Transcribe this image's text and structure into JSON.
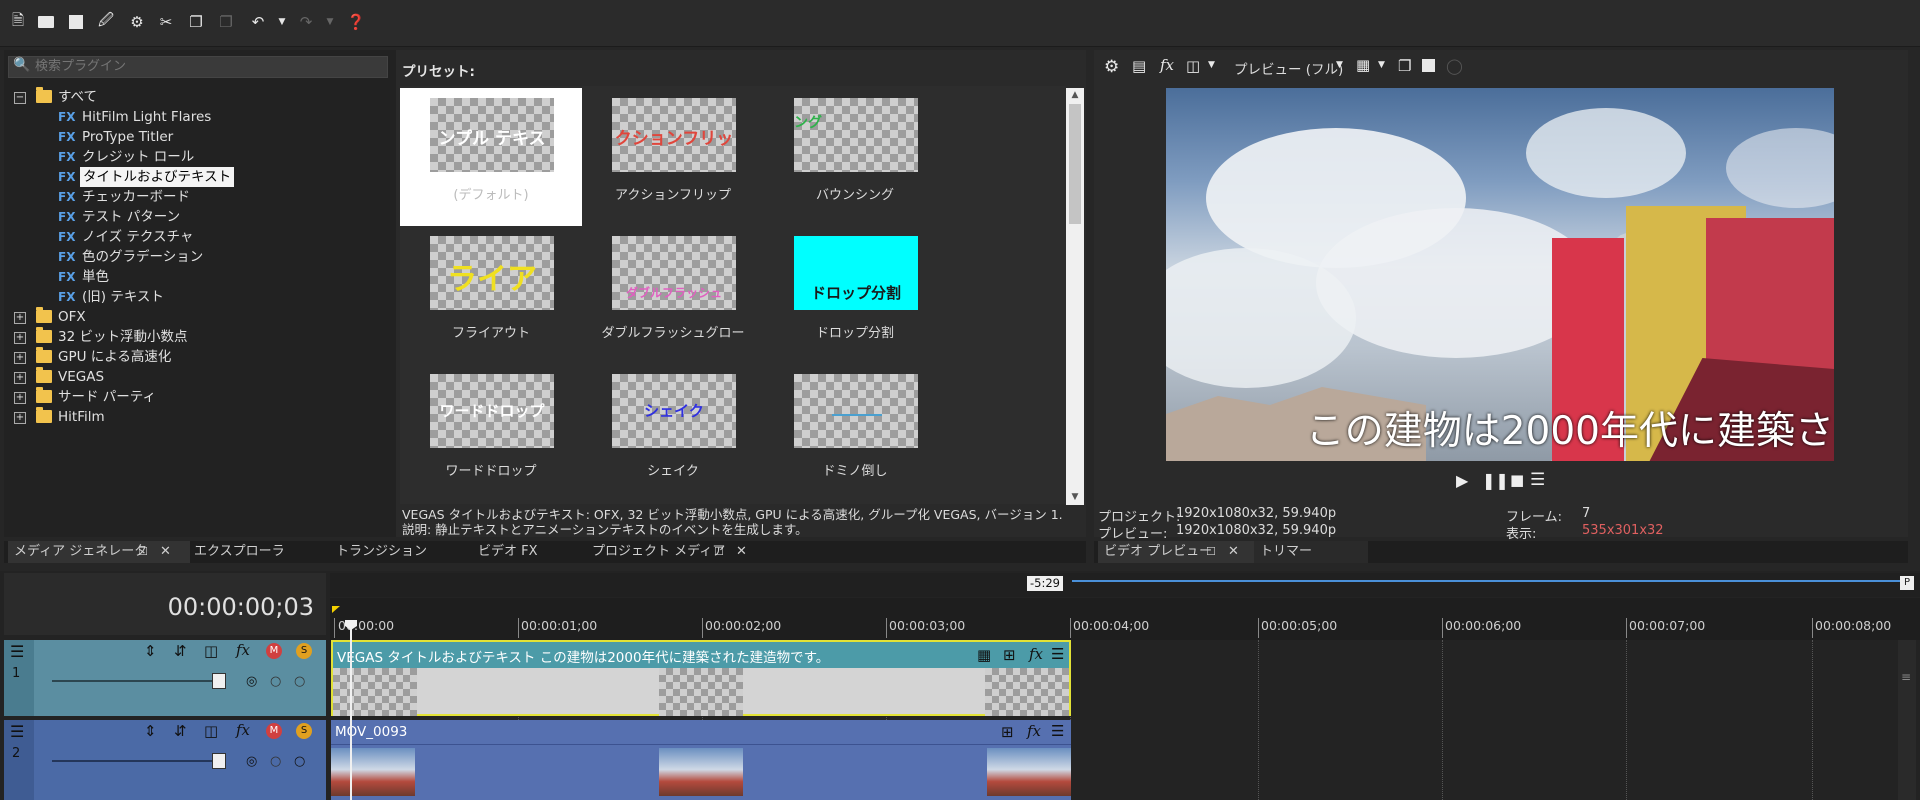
{
  "toolbar": {
    "icons": [
      "new-file-icon",
      "open-folder-icon",
      "save-icon",
      "save-as-icon",
      "settings-icon",
      "cut-icon",
      "copy-icon",
      "paste-icon",
      "undo-icon",
      "undo-dropdown-icon",
      "redo-icon",
      "redo-dropdown-icon",
      "help-pointer-icon"
    ]
  },
  "plugins": {
    "search_placeholder": "検索プラグイン",
    "root": "すべて",
    "items": [
      "HitFilm Light Flares",
      "ProType Titler",
      "クレジット ロール",
      "タイトルおよびテキスト",
      "チェッカーボード",
      "テスト パターン",
      "ノイズ テクスチャ",
      "色のグラデーション",
      "単色",
      "(旧) テキスト"
    ],
    "fx_badge": "FX",
    "folders": [
      "OFX",
      "32 ビット浮動小数点",
      "GPU による高速化",
      "VEGAS",
      "サード パーティ",
      "HitFilm"
    ]
  },
  "presets": {
    "header": "プリセット:",
    "cells": [
      {
        "label": "(デフォルト)",
        "thumb_text": "ンプル テキス",
        "thumb_color": "#ffffff"
      },
      {
        "label": "アクションフリップ",
        "thumb_text": "クションフリッ",
        "thumb_color": "#e0463c"
      },
      {
        "label": "バウンシング",
        "thumb_text": "ング",
        "thumb_color": "#2db24a"
      },
      {
        "label": "フライアウト",
        "thumb_text": "ライア",
        "thumb_color": "#f0e020"
      },
      {
        "label": "ダブルフラッシュグロー",
        "thumb_text": "ダブルフラッシュ",
        "thumb_color": "#e060c0"
      },
      {
        "label": "ドロップ分割",
        "thumb_text": "ドロップ分割",
        "thumb_color": "#1a1a1a"
      },
      {
        "label": "ワードドロップ",
        "thumb_text": "ワードドロップ",
        "thumb_color": "#ffffff"
      },
      {
        "label": "シェイク",
        "thumb_text": "シェイク",
        "thumb_color": "#3030e0"
      },
      {
        "label": "ドミノ倒し",
        "thumb_text": "",
        "thumb_color": "#4aa0d0"
      }
    ],
    "desc_line1": "VEGAS タイトルおよびテキスト: OFX, 32 ビット浮動小数点, GPU による高速化, グループ化 VEGAS, バージョン 1.",
    "desc_line2": "説明: 静止テキストとアニメーションテキストのイベントを生成します。"
  },
  "preview": {
    "mode_label": "プレビュー (フル)",
    "overlay_text": "この建物は2000年代に建築さ",
    "project_label": "プロジェクト:",
    "project_value": "1920x1080x32, 59.940p",
    "preview_label": "プレビュー:",
    "preview_value": "1920x1080x32, 59.940p",
    "frame_label": "フレーム:",
    "frame_value": "7",
    "display_label": "表示:",
    "display_value": "535x301x32",
    "display_value_color": "#e06060"
  },
  "tabs_left": [
    {
      "label": "メディア ジェネレータ",
      "active": true
    },
    {
      "label": "エクスプローラ",
      "active": false
    },
    {
      "label": "トランジション",
      "active": false
    },
    {
      "label": "ビデオ FX",
      "active": false
    },
    {
      "label": "プロジェクト メディア",
      "active": false
    }
  ],
  "tabs_right": [
    {
      "label": "ビデオ プレビュー",
      "active": true
    },
    {
      "label": "トリマー",
      "active": false
    }
  ],
  "timeline": {
    "timecode": "00:00:00;03",
    "marker": "-5:29",
    "ruler": [
      "00:00:00",
      "00:00:01;00",
      "00:00:02;00",
      "00:00:03;00",
      "00:00:04;00",
      "00:00:05;00",
      "00:00:06;00",
      "00:00:07;00",
      "00:00:08;00"
    ],
    "tracks": [
      {
        "number": "1",
        "clip_title": "VEGAS タイトルおよびテキスト この建物は2000年代に建築された建造物です。",
        "header_color": "#5b8ea1",
        "clip_color": "#4c9ba8"
      },
      {
        "number": "2",
        "clip_title": "MOV_0093",
        "header_color": "#4b6aa6",
        "clip_color": "#5670b0"
      }
    ]
  }
}
